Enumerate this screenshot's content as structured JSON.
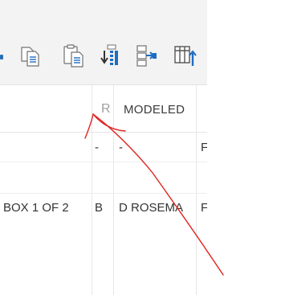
{
  "toolbar": {
    "buttons": [
      {
        "name": "copy-button",
        "icon": "copy-icon"
      },
      {
        "name": "paste-button",
        "icon": "clipboard-icon"
      },
      {
        "name": "download-list-button",
        "icon": "download-list-icon"
      },
      {
        "name": "hierarchy-button",
        "icon": "hierarchy-icon"
      },
      {
        "name": "column-settings-button",
        "icon": "column-settings-icon"
      }
    ]
  },
  "table": {
    "columns": {
      "rev": "R",
      "modeled": "MODELED"
    },
    "rows": [
      {
        "description": "",
        "rev": "-",
        "modeled": "-",
        "next": "F"
      },
      {
        "description": "",
        "rev": "",
        "modeled": "",
        "next": ""
      },
      {
        "description": "BOX 1 OF 2",
        "rev": "B",
        "modeled": "D ROSEMA",
        "next": "F"
      }
    ]
  },
  "colors": {
    "toolbar_bg": "#f3f3f3",
    "icon_blue": "#1f6cc1",
    "annotation_red": "#e0221c"
  }
}
